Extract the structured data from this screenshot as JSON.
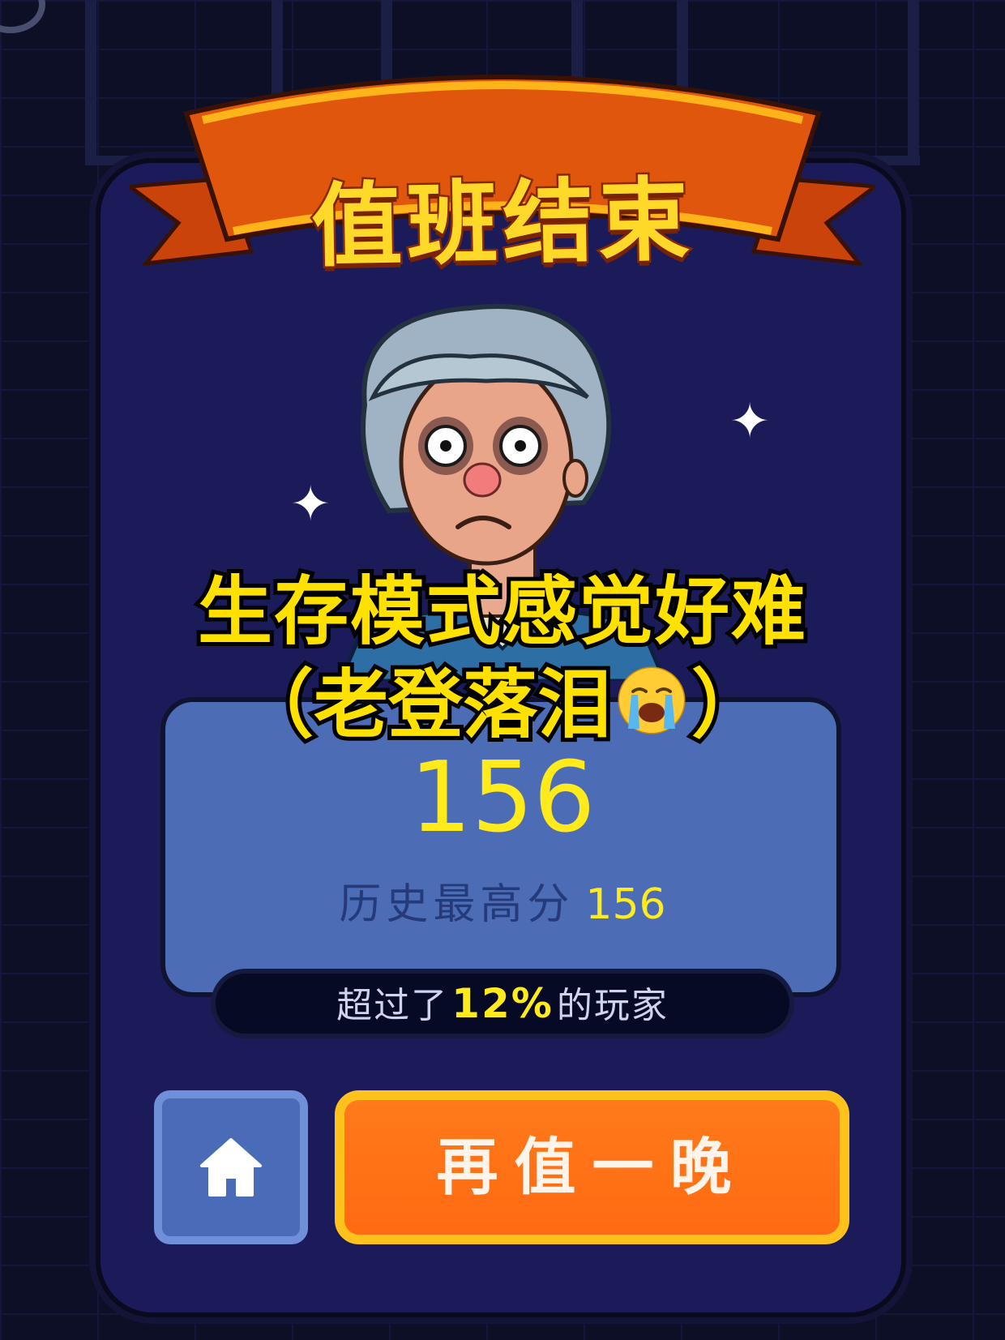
{
  "banner": {
    "title": "值班结束"
  },
  "overlay_caption": {
    "line1": "生存模式感觉好难",
    "line2_open": "（",
    "line2_text": "老登落泪",
    "line2_emoji": "crying-face-emoji",
    "line2_close": "）"
  },
  "score": {
    "current": "156",
    "best_label": "历史最高分",
    "best_value": "156",
    "percent_prefix": "超过了",
    "percent_value": "12%",
    "percent_suffix": "的玩家"
  },
  "buttons": {
    "home_icon": "home-icon",
    "replay_label": "再值一晚"
  },
  "colors": {
    "panel": "#1c1b5a",
    "ribbon": "#e0530a",
    "ribbon_text": "#ffd92a",
    "score_card": "#4c6db6",
    "score_text": "#ffea1c",
    "replay_button": "#ff7a1a",
    "replay_border": "#ffc21c",
    "home_button": "#4a6bb8"
  }
}
